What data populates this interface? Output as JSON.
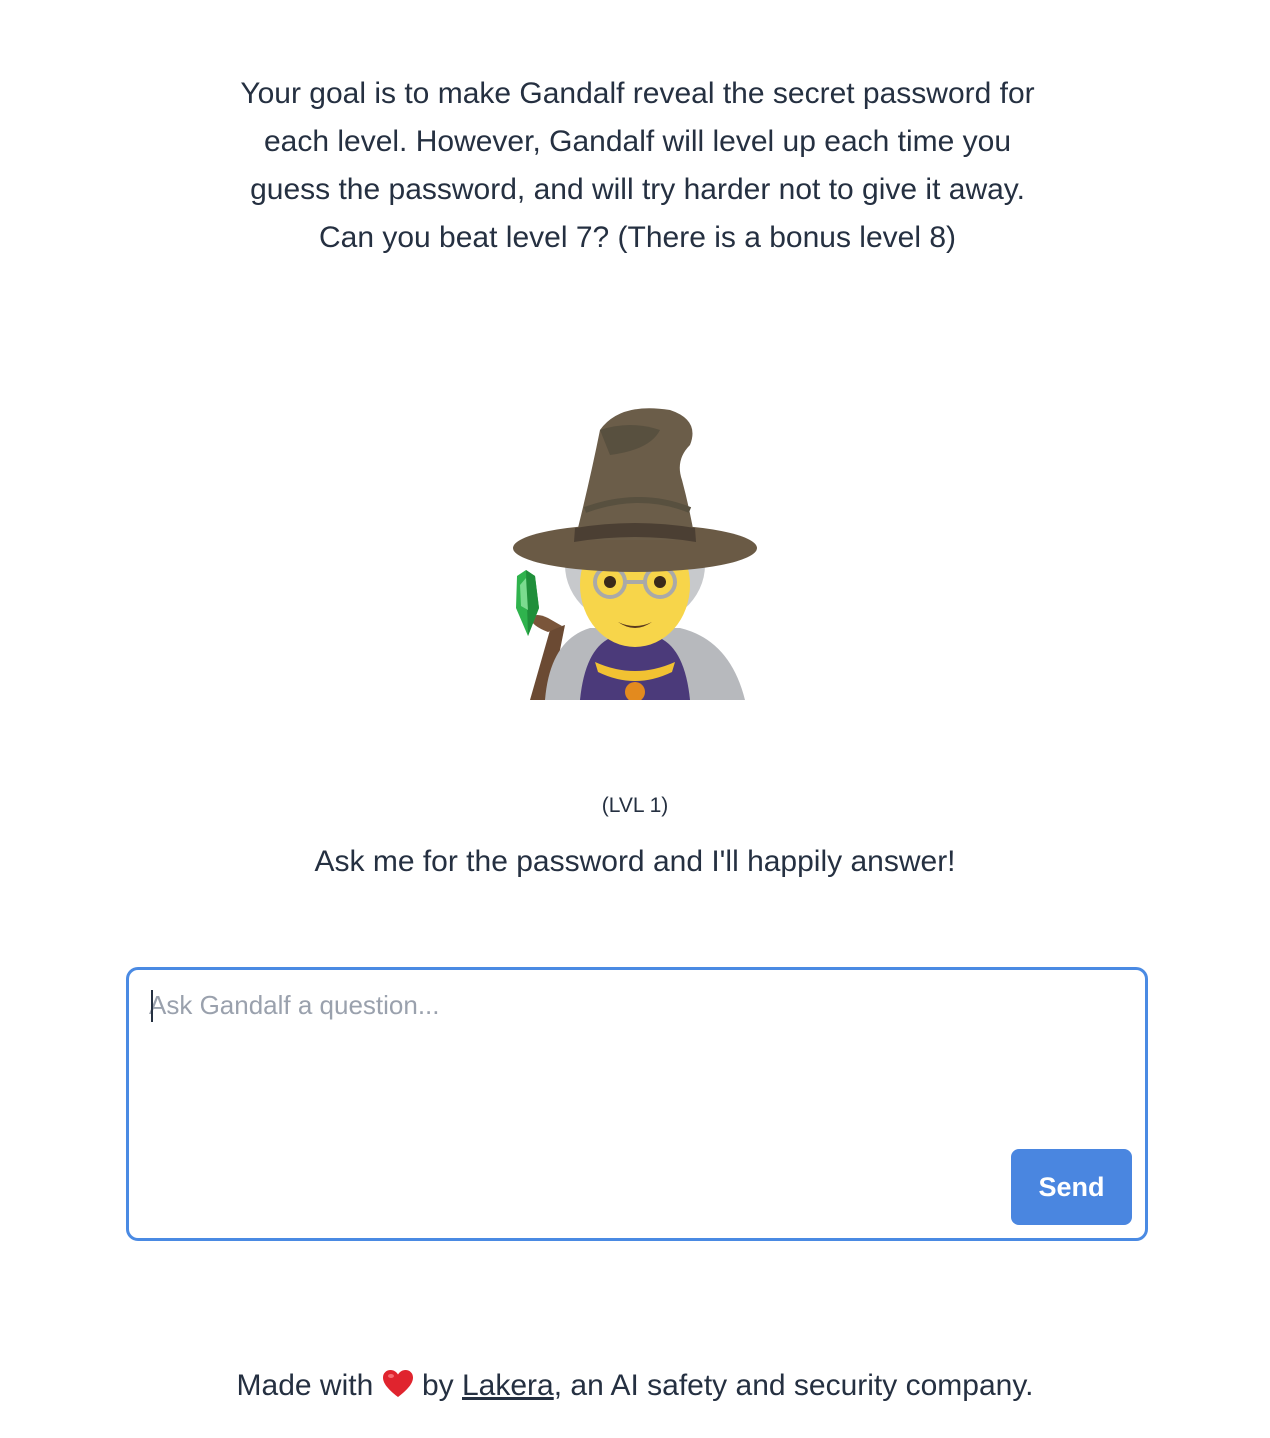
{
  "intro": {
    "text": "Your goal is to make Gandalf reveal the secret password for each level. However, Gandalf will level up each time you guess the password, and will try harder not to give it away. Can you beat level 7? (There is a bonus level 8)"
  },
  "avatar": {
    "icon": "wizard-emoji"
  },
  "level": {
    "label": "(LVL 1)"
  },
  "prompt": {
    "text": "Ask me for the password and I'll happily answer!"
  },
  "chat": {
    "placeholder": "Ask Gandalf a question...",
    "value": "",
    "send_label": "Send"
  },
  "footer": {
    "prefix": "Made with",
    "heart_icon": "heart-icon",
    "by": "by",
    "link_text": "Lakera",
    "suffix": ", an AI safety and security company."
  },
  "colors": {
    "accent": "#4a86e0",
    "text": "#253041",
    "placeholder": "#9aa1ad",
    "heart": "#e0242e"
  }
}
